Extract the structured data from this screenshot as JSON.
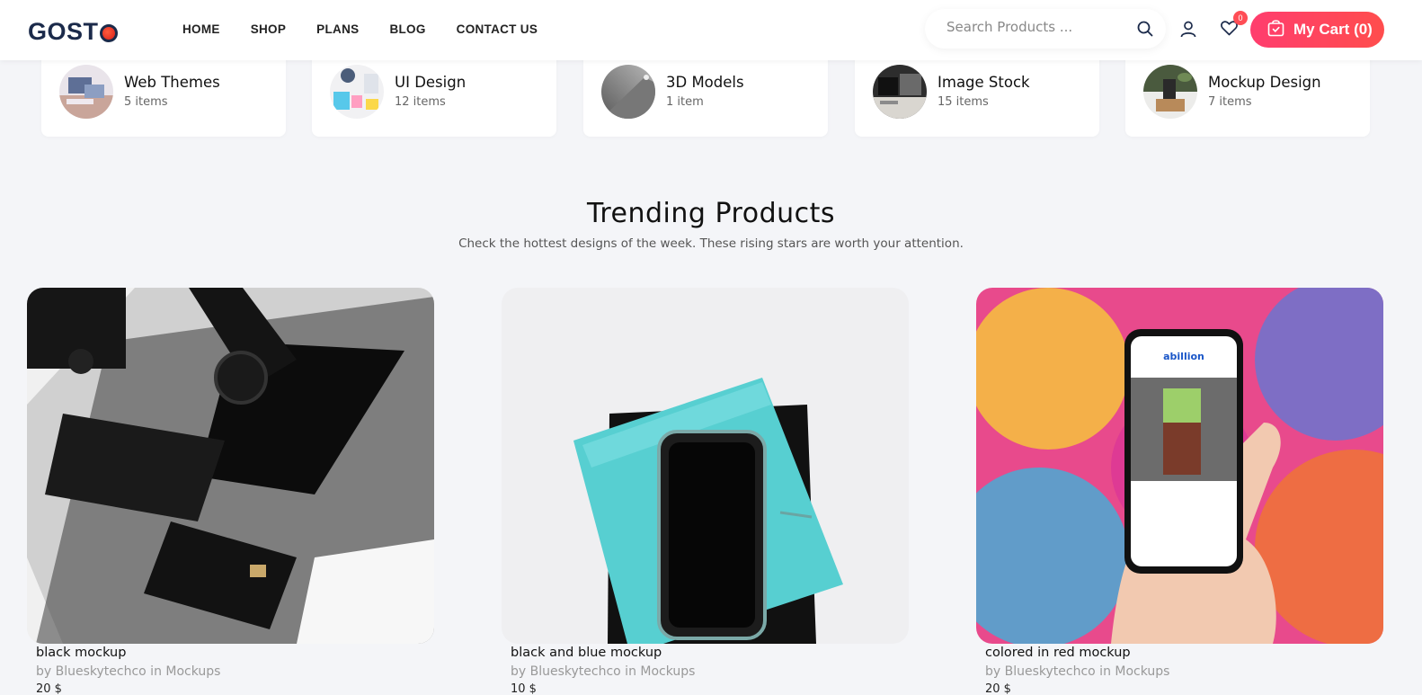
{
  "header": {
    "logo_text": "GOST",
    "nav": [
      "HOME",
      "SHOP",
      "PLANS",
      "BLOG",
      "CONTACT US"
    ],
    "search_placeholder": "Search Products ...",
    "wishlist_count": "0",
    "cart_label": "My Cart (0)",
    "accent_color": "#ff4d5e"
  },
  "categories": [
    {
      "name": "Web Themes",
      "count": "5 items"
    },
    {
      "name": "UI Design",
      "count": "12 items"
    },
    {
      "name": "3D Models",
      "count": "1 item"
    },
    {
      "name": "Image Stock",
      "count": "15 items"
    },
    {
      "name": "Mockup Design",
      "count": "7 items"
    }
  ],
  "section": {
    "title": "Trending Products",
    "subtitle": "Check the hottest designs of the week. These rising stars are worth your attention."
  },
  "products": [
    {
      "name": "black mockup",
      "by": "by Blueskytechco in Mockups",
      "price": "20 $"
    },
    {
      "name": "black and blue mockup",
      "by": "by Blueskytechco in Mockups",
      "price": "10 $"
    },
    {
      "name": "colored in red mockup",
      "by": "by Blueskytechco in Mockups",
      "price": "20 $"
    }
  ]
}
